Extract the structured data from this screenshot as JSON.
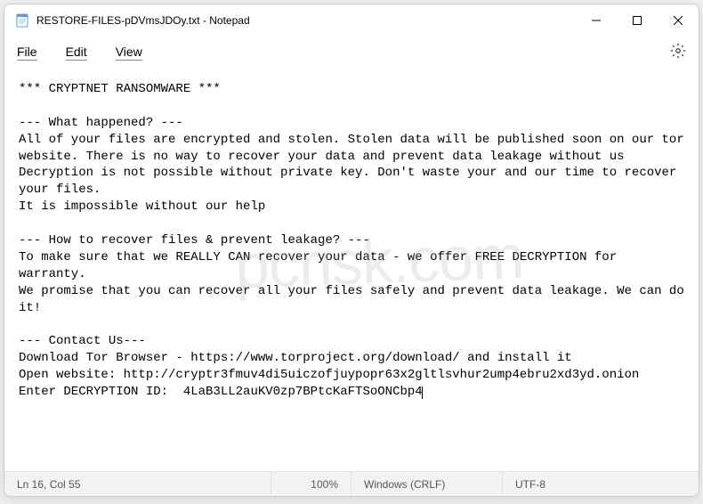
{
  "window": {
    "title": "RESTORE-FILES-pDVmsJDOy.txt - Notepad"
  },
  "menu": {
    "file": "File",
    "edit": "Edit",
    "view": "View"
  },
  "content": {
    "body": "*** CRYPTNET RANSOMWARE ***\n\n--- What happened? ---\nAll of your files are encrypted and stolen. Stolen data will be published soon on our tor website. There is no way to recover your data and prevent data leakage without us\nDecryption is not possible without private key. Don't waste your and our time to recover your files.\nIt is impossible without our help\n\n--- How to recover files & prevent leakage? ---\nTo make sure that we REALLY CAN recover your data - we offer FREE DECRYPTION for warranty.\nWe promise that you can recover all your files safely and prevent data leakage. We can do it!\n\n--- Contact Us---\nDownload Tor Browser - https://www.torproject.org/download/ and install it\nOpen website: http://cryptr3fmuv4di5uiczofjuypopr63x2gltlsvhur2ump4ebru2xd3yd.onion\nEnter DECRYPTION ID:  4LaB3LL2auKV0zp7BPtcKaFTSoONCbp4"
  },
  "status": {
    "position": "Ln 16, Col 55",
    "zoom": "100%",
    "lineending": "Windows (CRLF)",
    "encoding": "UTF-8"
  },
  "watermark": {
    "part1": "pc",
    "part2": "risk.com"
  }
}
